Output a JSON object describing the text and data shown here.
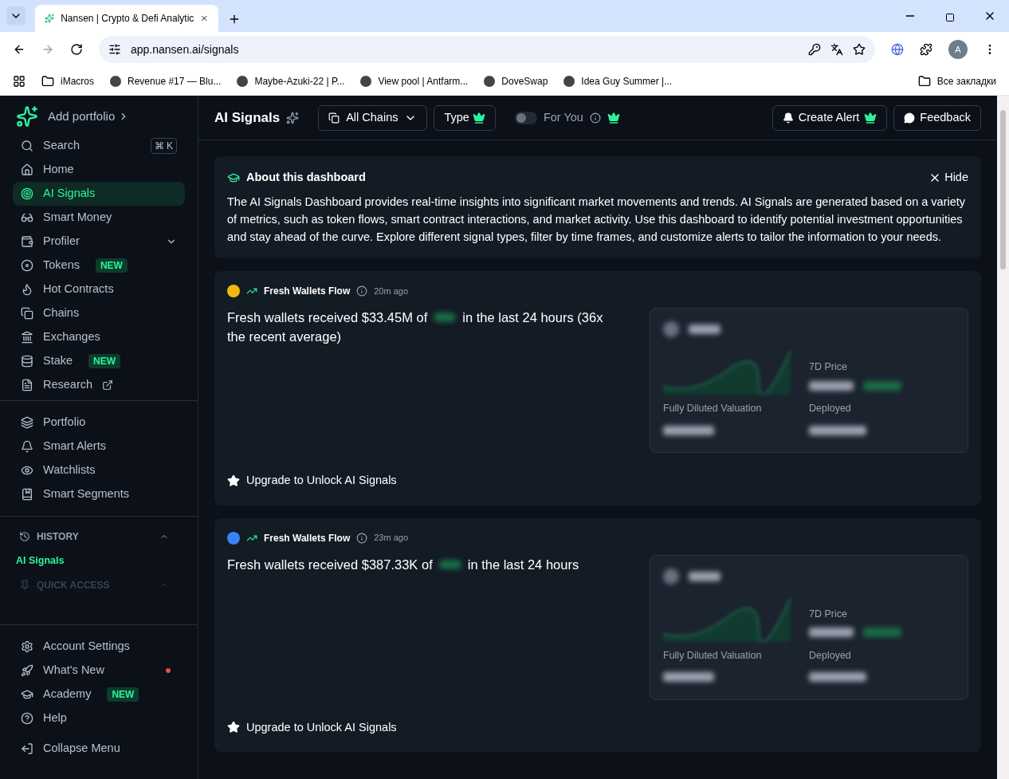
{
  "browser": {
    "tab_title": "Nansen | Crypto & Defi Analytic",
    "url": "app.nansen.ai/signals",
    "profile_initial": "A",
    "bookmarks": [
      {
        "label": "iMacros"
      },
      {
        "label": "Revenue #17 — Blu..."
      },
      {
        "label": "Maybe-Azuki-22 | P..."
      },
      {
        "label": "View pool | Antfarm..."
      },
      {
        "label": "DoveSwap"
      },
      {
        "label": "Idea Guy Summer |..."
      }
    ],
    "other_bookmarks": "Все закладки"
  },
  "sidebar": {
    "brand_label": "Add portfolio",
    "search": {
      "label": "Search",
      "shortcut": "⌘ K"
    },
    "nav": [
      {
        "label": "Home",
        "selected": false
      },
      {
        "label": "AI Signals",
        "selected": true
      },
      {
        "label": "Smart Money",
        "selected": false
      },
      {
        "label": "Profiler",
        "selected": false
      },
      {
        "label": "Tokens",
        "badge": "NEW",
        "selected": false
      },
      {
        "label": "Hot Contracts",
        "selected": false
      },
      {
        "label": "Chains",
        "selected": false
      },
      {
        "label": "Exchanges",
        "selected": false
      },
      {
        "label": "Stake",
        "badge": "NEW",
        "selected": false
      },
      {
        "label": "Research",
        "selected": false
      }
    ],
    "tools": [
      {
        "label": "Portfolio"
      },
      {
        "label": "Smart Alerts"
      },
      {
        "label": "Watchlists"
      },
      {
        "label": "Smart Segments"
      }
    ],
    "sections": [
      {
        "title": "HISTORY",
        "expanded": true,
        "disabled": false,
        "items": [
          {
            "label": "AI Signals"
          }
        ]
      },
      {
        "title": "QUICK ACCESS",
        "expanded": true,
        "disabled": true
      }
    ],
    "footer": [
      {
        "label": "Account Settings",
        "unread": false
      },
      {
        "label": "What's New",
        "unread": true
      },
      {
        "label": "Academy",
        "badge": "NEW",
        "unread": false
      },
      {
        "label": "Help",
        "unread": false
      }
    ],
    "collapse_label": "Collapse Menu"
  },
  "header": {
    "title": "AI Signals",
    "chain_filter": "All Chains",
    "type_filter": "Type",
    "toggle": {
      "label": "For You",
      "on": false
    },
    "create_alert": "Create Alert",
    "feedback": "Feedback"
  },
  "about": {
    "title": "About this dashboard",
    "hide_label": "Hide",
    "body": "The AI Signals Dashboard provides real-time insights into significant market movements and trends. AI Signals are generated based on a variety of metrics, such as token flows, smart contract interactions, and market activity. Use this dashboard to identify potential investment opportunities and stay ahead of the curve. Explore different signal types, filter by time frames, and customize alerts to tailor the information to your needs."
  },
  "signals": [
    {
      "color": "#f0b90b",
      "type": "Fresh Wallets Flow",
      "time": "20m ago",
      "text_before": "Fresh wallets received $33.45M of",
      "text_after": "in the last 24 hours (36x the recent average)",
      "price_label": "7D Price",
      "fdv_label": "Fully Diluted Valuation",
      "deployed_label": "Deployed",
      "upgrade": "Upgrade to Unlock AI Signals"
    },
    {
      "color": "#3b82f6",
      "type": "Fresh Wallets Flow",
      "time": "23m ago",
      "text_before": "Fresh wallets received $387.33K of",
      "text_after": "in the last 24 hours",
      "price_label": "7D Price",
      "fdv_label": "Fully Diluted Valuation",
      "deployed_label": "Deployed",
      "upgrade": "Upgrade to Unlock AI Signals"
    }
  ]
}
